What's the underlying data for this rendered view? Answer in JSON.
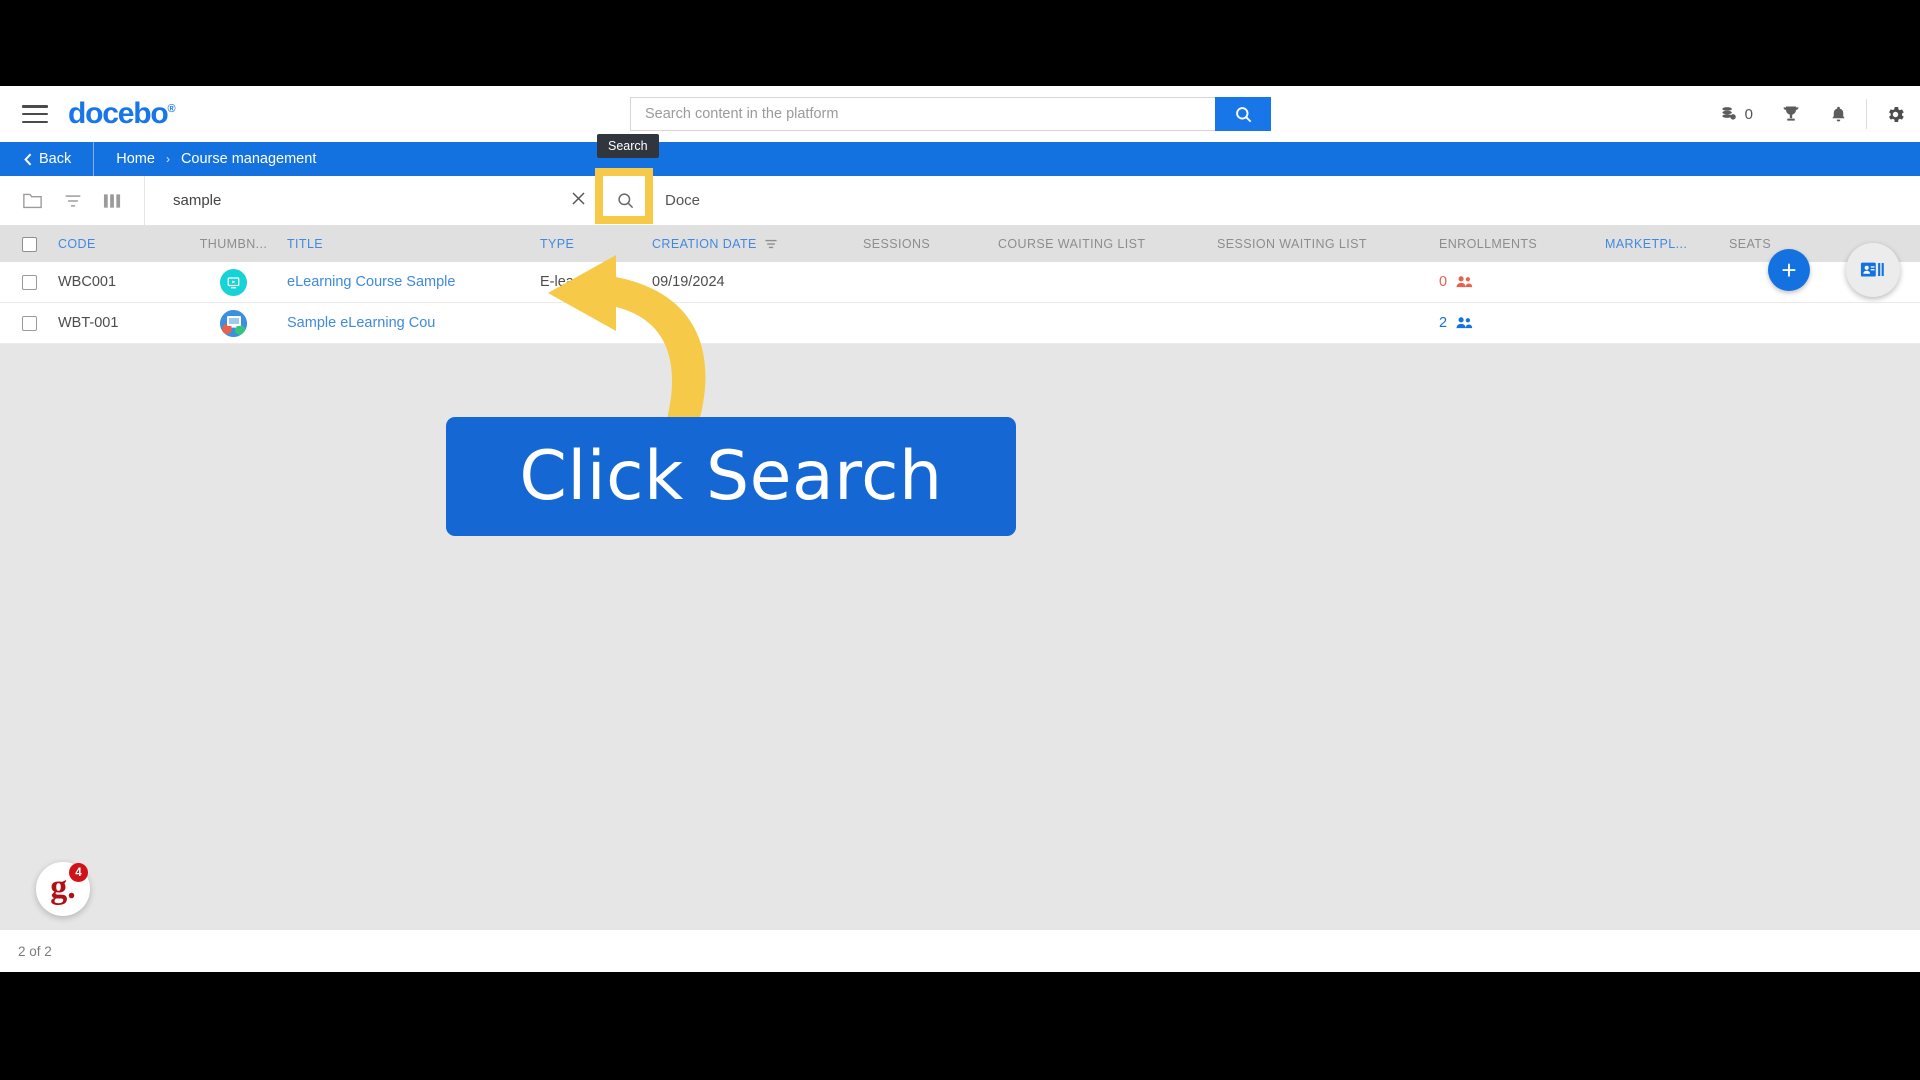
{
  "header": {
    "brand": "docebo",
    "brand_mark": "®",
    "menu_icon": "hamburger-icon",
    "search": {
      "placeholder": "Search content in the platform",
      "value": "",
      "button_icon": "search-icon"
    },
    "right_items": [
      {
        "icon": "coins-icon",
        "label": "0"
      },
      {
        "icon": "trophy-icon",
        "label": ""
      },
      {
        "icon": "bell-icon",
        "label": ""
      },
      {
        "icon": "gear-icon",
        "label": ""
      }
    ]
  },
  "breadcrumb": {
    "back_label": "Back",
    "back_icon": "chevron-left-icon",
    "items": [
      "Home",
      "Course management"
    ],
    "separator": "›"
  },
  "toolbar": {
    "icons": [
      "folder-icon",
      "filter-icon",
      "columns-icon"
    ],
    "search_value": "sample",
    "search_placeholder": "",
    "clear_icon": "close-icon",
    "search_button_icon": "search-icon",
    "domain_label": "Doce",
    "tooltip": "Search"
  },
  "table": {
    "columns": [
      {
        "label": "CODE",
        "style": "blue"
      },
      {
        "label": "THUMBN...",
        "style": "gray"
      },
      {
        "label": "TITLE",
        "style": "blue"
      },
      {
        "label": "TYPE",
        "style": "blue"
      },
      {
        "label": "CREATION DATE",
        "style": "blue",
        "sorted": true
      },
      {
        "label": "SESSIONS",
        "style": "gray"
      },
      {
        "label": "COURSE WAITING LIST",
        "style": "gray"
      },
      {
        "label": "SESSION WAITING LIST",
        "style": "gray"
      },
      {
        "label": "ENROLLMENTS",
        "style": "gray"
      },
      {
        "label": "MARKETPL...",
        "style": "blue"
      },
      {
        "label": "SEATS",
        "style": "gray"
      }
    ],
    "rows": [
      {
        "code": "WBC001",
        "thumb_icon": "video-course-icon",
        "thumb_color": "#16d3d6",
        "title": "eLearning Course Sample",
        "type": "E-learning",
        "creation_date": "09/19/2024",
        "sessions": "",
        "course_waiting_list": "",
        "session_waiting_list": "",
        "enrollments": "0",
        "enrollments_color": "#e8614c",
        "marketplace": "",
        "seats": ""
      },
      {
        "code": "WBT-001",
        "thumb_icon": "presentation-icon",
        "thumb_color": "#3b8fe0",
        "title": "Sample eLearning Cou",
        "type": "",
        "creation_date": "",
        "sessions": "",
        "course_waiting_list": "",
        "session_waiting_list": "",
        "enrollments": "2",
        "enrollments_color": "#1472e0",
        "marketplace": "",
        "seats": ""
      }
    ]
  },
  "actions": {
    "add_label": "+",
    "add_icon": "plus-icon",
    "card_icon": "id-card-icon"
  },
  "chat_widget": {
    "logo": "g.",
    "badge": "4"
  },
  "footer": {
    "count_label": "2 of 2"
  },
  "annotation": {
    "callout_text": "Click Search",
    "callout_color": "#1568d3",
    "arrow_color": "#f7c948",
    "highlight_color": "#f7c948"
  }
}
